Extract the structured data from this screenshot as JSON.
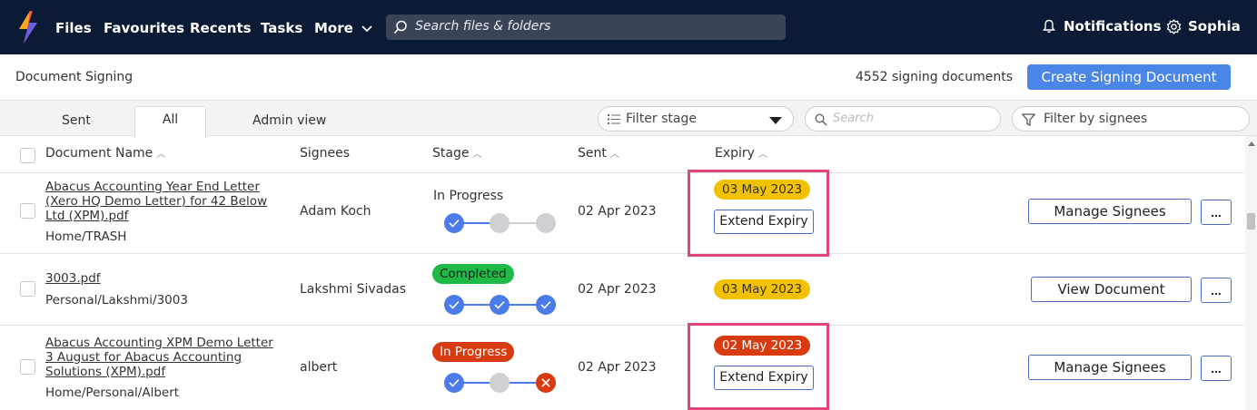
{
  "nav": {
    "items": [
      "Files",
      "Favourites",
      "Recents",
      "Tasks",
      "More"
    ],
    "search_placeholder": "Search files & folders",
    "notifications": "Notifications",
    "user": "Sophia"
  },
  "header": {
    "title": "Document Signing",
    "count": "4552 signing documents",
    "create_label": "Create Signing Document"
  },
  "tabs": [
    "Sent",
    "All",
    "Admin view"
  ],
  "active_tab": "All",
  "filters": {
    "stage": "Filter stage",
    "search_placeholder": "Search",
    "signees": "Filter by signees"
  },
  "columns": {
    "name": "Document Name",
    "signees": "Signees",
    "stage": "Stage",
    "sent": "Sent",
    "expiry": "Expiry"
  },
  "rows": [
    {
      "name": "Abacus Accounting Year End Letter (Xero HQ Demo Letter) for 42 Below Ltd (XPM).pdf",
      "path": "Home/TRASH",
      "signee": "Adam Koch",
      "stage": "In Progress",
      "stage_style": "plain",
      "steps": [
        "done",
        "pending",
        "pending"
      ],
      "sent": "02 Apr 2023",
      "expiry": "03 May 2023",
      "expiry_status": "warning",
      "extend_label": "Extend Expiry",
      "action": "Manage Signees",
      "more": "..."
    },
    {
      "name": "3003.pdf",
      "path": "Personal/Lakshmi/3003",
      "signee": "Lakshmi Sivadas",
      "stage": "Completed",
      "stage_style": "green",
      "steps": [
        "done",
        "done",
        "done"
      ],
      "sent": "02 Apr 2023",
      "expiry": "03 May 2023",
      "expiry_status": "warning",
      "extend_label": "",
      "action": "View Document",
      "more": "..."
    },
    {
      "name": "Abacus Accounting XPM Demo Letter 3 August for Abacus Accounting Solutions (XPM).pdf",
      "path": "Home/Personal/Albert",
      "signee": "albert",
      "stage": "In Progress",
      "stage_style": "red",
      "steps": [
        "done",
        "pending",
        "rejected"
      ],
      "sent": "02 Apr 2023",
      "expiry": "02 May 2023",
      "expiry_status": "expired",
      "extend_label": "Extend Expiry",
      "action": "Manage Signees",
      "more": "..."
    }
  ],
  "colors": {
    "nav_bg": "#0b1a35",
    "primary": "#4a86e8",
    "step_done": "#4a7be8",
    "step_pending": "#cfd0d3",
    "completed": "#1eb946",
    "danger": "#d83b10",
    "warning": "#f2c200",
    "highlight": "#e0457b"
  }
}
